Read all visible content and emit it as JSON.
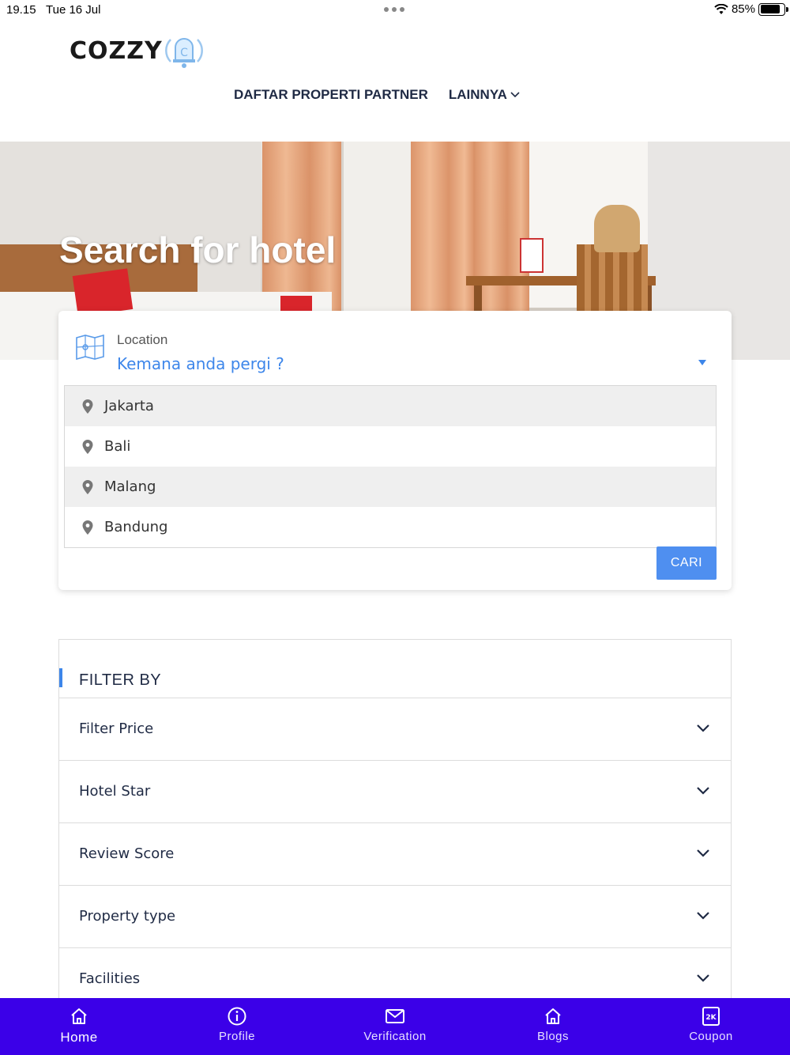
{
  "status_bar": {
    "time": "19.15",
    "date": "Tue 16 Jul",
    "battery": "85%",
    "battery_level": 0.85
  },
  "header": {
    "logo_text": "COZZY",
    "logo_icon": "bell-icon",
    "nav": [
      {
        "label": "DAFTAR PROPERTI PARTNER"
      },
      {
        "label": "LAINNYA",
        "icon": "chevron-down-icon"
      }
    ]
  },
  "hero": {
    "title": "Search for hotel"
  },
  "search": {
    "location_label": "Location",
    "location_placeholder": "Kemana anda pergi ?",
    "suggestions": [
      "Jakarta",
      "Bali",
      "Malang",
      "Bandung"
    ],
    "submit_label": "CARI",
    "accent_color": "#3d86ea"
  },
  "filter": {
    "title": "FILTER BY",
    "rows": [
      "Filter Price",
      "Hotel Star",
      "Review Score",
      "Property type",
      "Facilities"
    ]
  },
  "bottom_nav": {
    "background_color": "#3b00e8",
    "items": [
      {
        "label": "Home",
        "icon": "home-icon",
        "active": true
      },
      {
        "label": "Profile",
        "icon": "info-icon"
      },
      {
        "label": "Verification",
        "icon": "mail-icon"
      },
      {
        "label": "Blogs",
        "icon": "home-icon"
      },
      {
        "label": "Coupon",
        "icon": "coupon-icon"
      }
    ]
  }
}
